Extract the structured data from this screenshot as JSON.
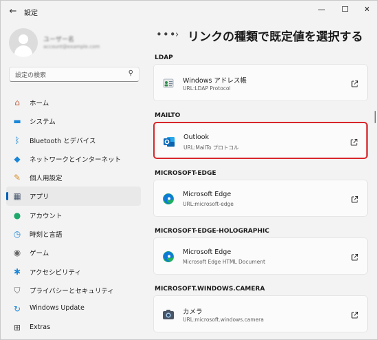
{
  "window": {
    "title": "設定",
    "back_glyph": "←",
    "minimize_glyph": "—",
    "maximize_glyph": "☐",
    "close_glyph": "✕"
  },
  "sidebar": {
    "search_placeholder": "設定の検索",
    "items": [
      {
        "label": "ホーム",
        "icon": "home-icon",
        "glyph": "⌂",
        "color": "#c25b39"
      },
      {
        "label": "システム",
        "icon": "system-icon",
        "glyph": "▬",
        "color": "#1a86d9"
      },
      {
        "label": "Bluetooth とデバイス",
        "icon": "bluetooth-icon",
        "glyph": "ᛒ",
        "color": "#1a86d9"
      },
      {
        "label": "ネットワークとインターネット",
        "icon": "network-icon",
        "glyph": "◆",
        "color": "#1a86d9"
      },
      {
        "label": "個人用設定",
        "icon": "brush-icon",
        "glyph": "✎",
        "color": "#d98c2a"
      },
      {
        "label": "アプリ",
        "icon": "apps-icon",
        "glyph": "▦",
        "color": "#4a5a70",
        "active": true
      },
      {
        "label": "アカウント",
        "icon": "account-icon",
        "glyph": "●",
        "color": "#1fa86b"
      },
      {
        "label": "時刻と言語",
        "icon": "time-language-icon",
        "glyph": "◷",
        "color": "#1a86d9"
      },
      {
        "label": "ゲーム",
        "icon": "game-icon",
        "glyph": "◉",
        "color": "#666666"
      },
      {
        "label": "アクセシビリティ",
        "icon": "accessibility-icon",
        "glyph": "✱",
        "color": "#1a86d9"
      },
      {
        "label": "プライバシーとセキュリティ",
        "icon": "shield-icon",
        "glyph": "⛉",
        "color": "#666666"
      },
      {
        "label": "Windows Update",
        "icon": "windows-update-icon",
        "glyph": "↻",
        "color": "#1a86d9"
      }
    ],
    "extras_label": "Extras"
  },
  "header": {
    "dots": "•••",
    "separator": "›",
    "title": "リンクの種類で既定値を選択する"
  },
  "sections": [
    {
      "label": "LDAP",
      "app_name": "Windows アドレス帳",
      "url": "URL:LDAP Protocol",
      "icon": "address-book-icon",
      "highlight": false
    },
    {
      "label": "MAILTO",
      "app_name": "Outlook",
      "url": "URL:MailTo プロトコル",
      "icon": "outlook-icon",
      "highlight": true
    },
    {
      "label": "MICROSOFT-EDGE",
      "app_name": "Microsoft Edge",
      "url": "URL:microsoft-edge",
      "icon": "edge-icon",
      "highlight": false
    },
    {
      "label": "MICROSOFT-EDGE-HOLOGRAPHIC",
      "app_name": "Microsoft Edge",
      "url": "Microsoft Edge HTML Document",
      "icon": "edge-icon",
      "highlight": false
    },
    {
      "label": "MICROSOFT.WINDOWS.CAMERA",
      "app_name": "カメラ",
      "url": "URL:microsoft.windows.camera",
      "icon": "camera-icon",
      "highlight": false
    }
  ],
  "colors": {
    "accent": "#005fb8",
    "highlight_border": "#d7262b"
  }
}
